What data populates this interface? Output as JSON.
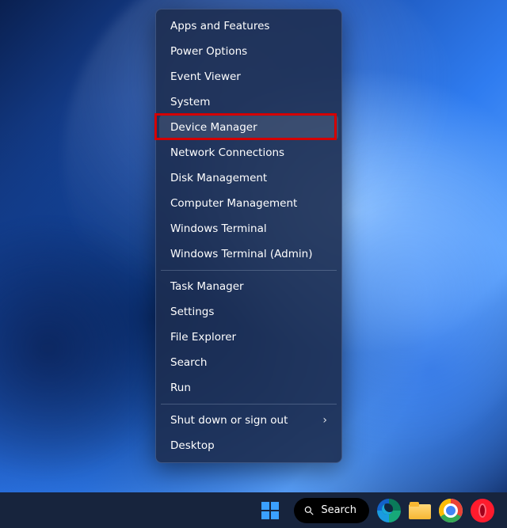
{
  "menu": {
    "groups": [
      [
        {
          "id": "apps-features",
          "label": "Apps and Features",
          "submenu": false,
          "hovered": false
        },
        {
          "id": "power-options",
          "label": "Power Options",
          "submenu": false,
          "hovered": false
        },
        {
          "id": "event-viewer",
          "label": "Event Viewer",
          "submenu": false,
          "hovered": false
        },
        {
          "id": "system",
          "label": "System",
          "submenu": false,
          "hovered": false
        },
        {
          "id": "device-manager",
          "label": "Device Manager",
          "submenu": false,
          "hovered": true,
          "highlighted": true
        },
        {
          "id": "network-connections",
          "label": "Network Connections",
          "submenu": false,
          "hovered": false
        },
        {
          "id": "disk-management",
          "label": "Disk Management",
          "submenu": false,
          "hovered": false
        },
        {
          "id": "computer-management",
          "label": "Computer Management",
          "submenu": false,
          "hovered": false
        },
        {
          "id": "windows-terminal",
          "label": "Windows Terminal",
          "submenu": false,
          "hovered": false
        },
        {
          "id": "windows-terminal-admin",
          "label": "Windows Terminal (Admin)",
          "submenu": false,
          "hovered": false
        }
      ],
      [
        {
          "id": "task-manager",
          "label": "Task Manager",
          "submenu": false,
          "hovered": false
        },
        {
          "id": "settings",
          "label": "Settings",
          "submenu": false,
          "hovered": false
        },
        {
          "id": "file-explorer",
          "label": "File Explorer",
          "submenu": false,
          "hovered": false
        },
        {
          "id": "search",
          "label": "Search",
          "submenu": false,
          "hovered": false
        },
        {
          "id": "run",
          "label": "Run",
          "submenu": false,
          "hovered": false
        }
      ],
      [
        {
          "id": "shut-down",
          "label": "Shut down or sign out",
          "submenu": true,
          "hovered": false
        },
        {
          "id": "desktop",
          "label": "Desktop",
          "submenu": false,
          "hovered": false
        }
      ]
    ]
  },
  "taskbar": {
    "search_label": "Search",
    "icons": [
      {
        "id": "start",
        "name": "start-button"
      },
      {
        "id": "search",
        "name": "search-pill"
      },
      {
        "id": "edge",
        "name": "edge-browser-icon"
      },
      {
        "id": "explorer",
        "name": "file-explorer-icon"
      },
      {
        "id": "chrome",
        "name": "chrome-browser-icon"
      },
      {
        "id": "opera",
        "name": "opera-browser-icon"
      }
    ]
  },
  "colors": {
    "menu_bg": "rgba(28,44,78,0.88)",
    "highlight": "#d40000",
    "taskbar": "#17243d"
  }
}
